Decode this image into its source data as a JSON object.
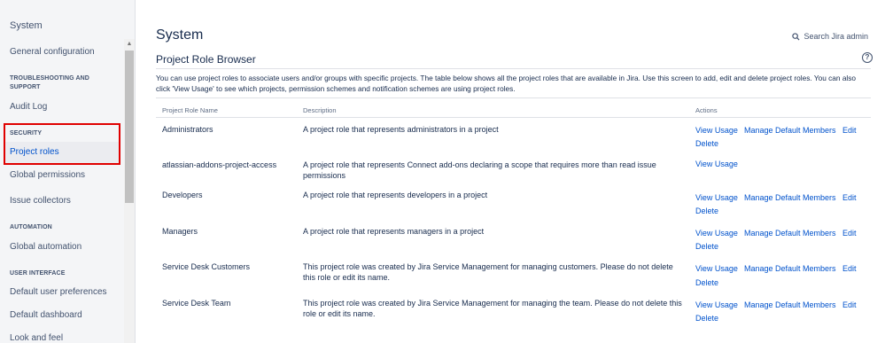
{
  "sidebar": {
    "title": "System",
    "items": [
      {
        "key": "general",
        "label": "General configuration"
      },
      {
        "key": "section-troubleshooting",
        "label": "TROUBLESHOOTING AND SUPPORT"
      },
      {
        "key": "audit",
        "label": "Audit Log"
      },
      {
        "key": "section-security",
        "label": "SECURITY"
      },
      {
        "key": "project-roles",
        "label": "Project roles",
        "selected": true
      },
      {
        "key": "global-permissions",
        "label": "Global permissions"
      },
      {
        "key": "issue-collectors",
        "label": "Issue collectors"
      },
      {
        "key": "section-automation",
        "label": "AUTOMATION"
      },
      {
        "key": "global-automation",
        "label": "Global automation"
      },
      {
        "key": "section-user-interface",
        "label": "USER INTERFACE"
      },
      {
        "key": "default-user-preferences",
        "label": "Default user preferences"
      },
      {
        "key": "default-dashboard",
        "label": "Default dashboard"
      },
      {
        "key": "look-and-feel",
        "label": "Look and feel"
      }
    ]
  },
  "header": {
    "title": "System",
    "search_label": "Search Jira admin",
    "search_icon": "search-icon"
  },
  "main": {
    "section_title": "Project Role Browser",
    "help_icon": "?",
    "intro": "You can use project roles to associate users and/or groups with specific projects. The table below shows all the project roles that are available in Jira. Use this screen to add, edit and delete project roles. You can also click 'View Usage' to see which projects, permission schemes and notification schemes are using project roles.",
    "table": {
      "columns": [
        "Project Role Name",
        "Description",
        "Actions"
      ],
      "rows": [
        {
          "name": "Administrators",
          "description": "A project role that represents administrators in a project",
          "actions": [
            "View Usage",
            "Manage Default Members",
            "Edit",
            "Delete"
          ]
        },
        {
          "name": "atlassian-addons-project-access",
          "description": "A project role that represents Connect add-ons declaring a scope that requires more than read issue permissions",
          "actions": [
            "View Usage"
          ]
        },
        {
          "name": "Developers",
          "description": "A project role that represents developers in a project",
          "actions": [
            "View Usage",
            "Manage Default Members",
            "Edit",
            "Delete"
          ]
        },
        {
          "name": "Managers",
          "description": "A project role that represents managers in a project",
          "actions": [
            "View Usage",
            "Manage Default Members",
            "Edit",
            "Delete"
          ]
        },
        {
          "name": "Service Desk Customers",
          "description": "This project role was created by Jira Service Management for managing customers. Please do not delete this role or edit its name.",
          "actions": [
            "View Usage",
            "Manage Default Members",
            "Edit",
            "Delete"
          ]
        },
        {
          "name": "Service Desk Team",
          "description": "This project role was created by Jira Service Management for managing the team. Please do not delete this role or edit its name.",
          "actions": [
            "View Usage",
            "Manage Default Members",
            "Edit",
            "Delete"
          ]
        }
      ]
    }
  },
  "colors": {
    "link": "#0052cc",
    "sidebar_bg": "#f4f5f7",
    "highlight": "#e00000"
  }
}
